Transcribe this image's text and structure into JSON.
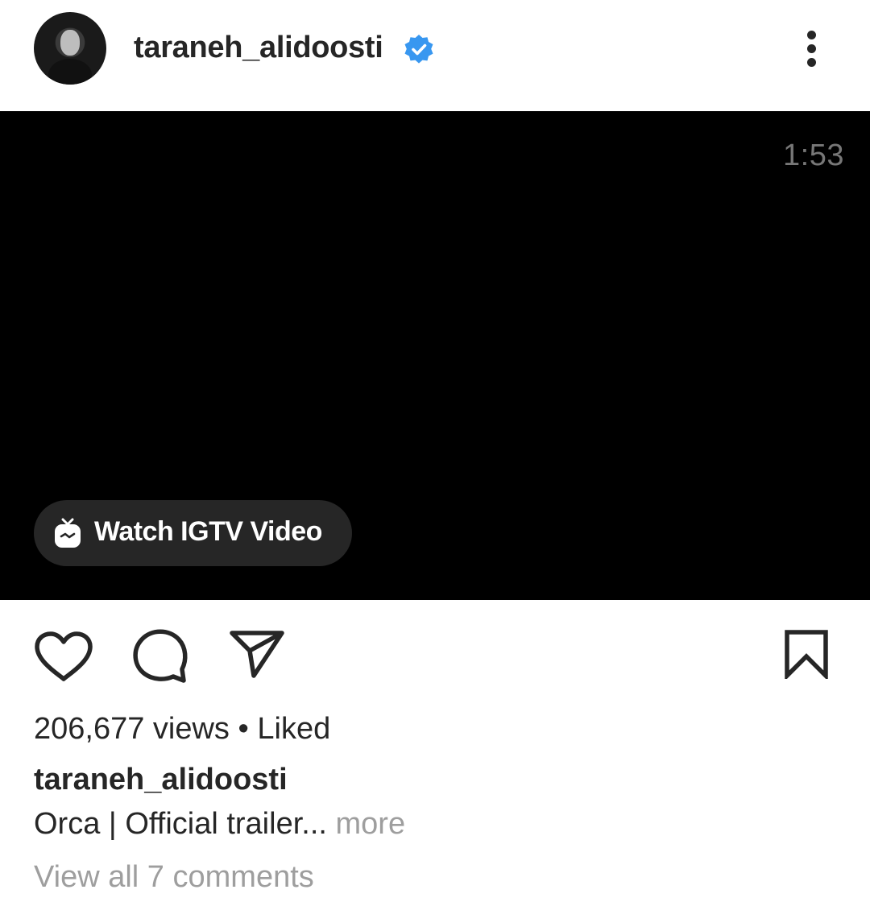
{
  "post": {
    "username": "taraneh_alidoosti",
    "verified_icon": "verified-badge-icon",
    "more_icon": "more-options-icon"
  },
  "video": {
    "duration": "1:53",
    "igtv_label": "Watch IGTV Video",
    "igtv_icon": "igtv-icon"
  },
  "actions": {
    "like_icon": "heart-icon",
    "comment_icon": "comment-icon",
    "share_icon": "send-icon",
    "save_icon": "bookmark-icon"
  },
  "stats": {
    "views": "206,677 views",
    "separator": "•",
    "liked": "Liked"
  },
  "caption": {
    "username": "taraneh_alidoosti",
    "text": "Orca | Official trailer",
    "ellipsis": "...",
    "more_label": "more"
  },
  "comments": {
    "view_all": "View all 7 comments"
  },
  "colors": {
    "text": "#262626",
    "secondary": "#9e9e9e",
    "verified": "#3897f0",
    "video_bg": "#000000"
  }
}
